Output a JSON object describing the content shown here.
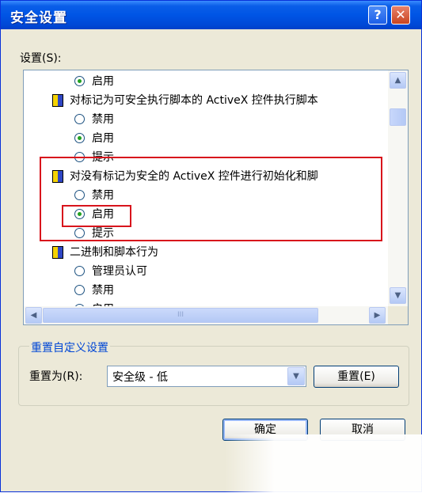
{
  "window": {
    "title": "安全设置",
    "help_glyph": "?",
    "close_glyph": "✕"
  },
  "settings_label": "设置(S):",
  "list": {
    "rows": [
      {
        "type": "radio",
        "label": "启用",
        "checked": true
      },
      {
        "type": "group",
        "label": "对标记为可安全执行脚本的 ActiveX 控件执行脚本"
      },
      {
        "type": "radio",
        "label": "禁用",
        "checked": false
      },
      {
        "type": "radio",
        "label": "启用",
        "checked": true
      },
      {
        "type": "radio",
        "label": "提示",
        "checked": false
      },
      {
        "type": "group",
        "label": "对没有标记为安全的 ActiveX 控件进行初始化和脚"
      },
      {
        "type": "radio",
        "label": "禁用",
        "checked": false
      },
      {
        "type": "radio",
        "label": "启用",
        "checked": true
      },
      {
        "type": "radio",
        "label": "提示",
        "checked": false
      },
      {
        "type": "group",
        "label": "二进制和脚本行为"
      },
      {
        "type": "radio",
        "label": "管理员认可",
        "checked": false
      },
      {
        "type": "radio",
        "label": "禁用",
        "checked": false
      },
      {
        "type": "radio",
        "label": "启用",
        "checked": false
      }
    ],
    "scroll_up": "▲",
    "scroll_down": "▼",
    "scroll_left": "◀",
    "scroll_right": "▶",
    "hthumb_grip": "III"
  },
  "reset_group": {
    "title": "重置自定义设置",
    "reset_to_label": "重置为(R):",
    "selected_level": "安全级 - 低",
    "dropdown_glyph": "▼",
    "reset_button": "重置(E)"
  },
  "buttons": {
    "ok": "确定",
    "cancel": "取消"
  },
  "colors": {
    "titlebar": "#0055e5",
    "highlight": "#d8141c",
    "group_title": "#0046d5",
    "radio_dot": "#21a121"
  }
}
